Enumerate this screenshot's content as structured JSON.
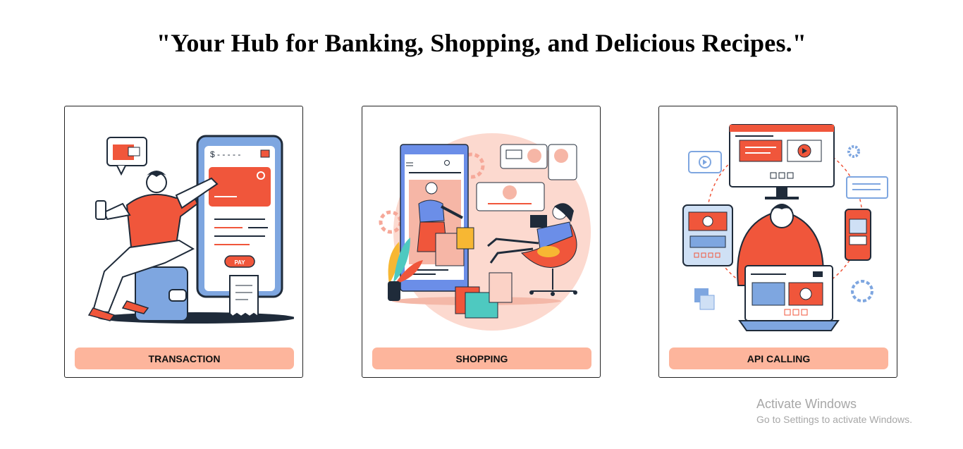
{
  "headline": "\"Your Hub for Banking, Shopping, and Delicious Recipes.\"",
  "cards": [
    {
      "label": "TRANSACTION",
      "art": {
        "pay_label": "PAY"
      }
    },
    {
      "label": "SHOPPING"
    },
    {
      "label": "API CALLING"
    }
  ],
  "watermark": {
    "title": "Activate Windows",
    "subtitle": "Go to Settings to activate Windows."
  },
  "colors": {
    "accent": "#fdb59c",
    "illustration_red": "#f0563b",
    "illustration_blue": "#7ea6e0",
    "dark": "#1f2b3a"
  }
}
